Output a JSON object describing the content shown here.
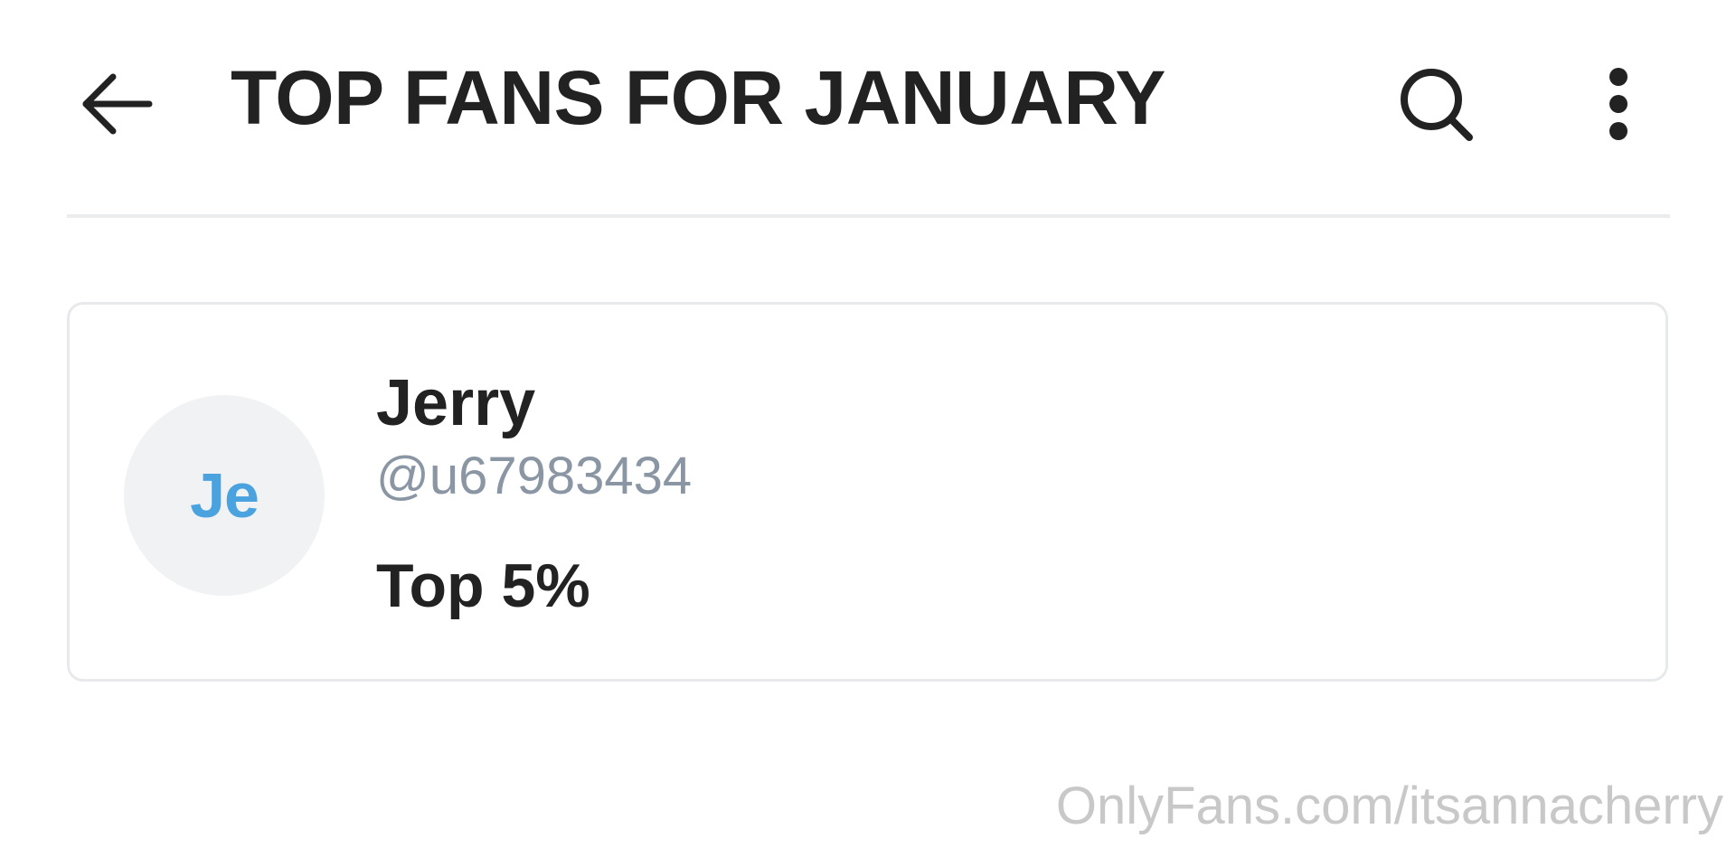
{
  "header": {
    "title": "TOP FANS FOR JANUARY",
    "back_icon": "arrow-left-icon",
    "search_icon": "search-icon",
    "more_icon": "more-vertical-icon"
  },
  "fan": {
    "initials": "Je",
    "name": "Jerry",
    "handle": "@u67983434",
    "rank": "Top 5%"
  },
  "watermark": "OnlyFans.com/itsannacherry",
  "colors": {
    "text_primary": "#222222",
    "text_secondary": "#8a96a3",
    "accent": "#4aa3df",
    "avatar_bg": "#f0f2f4",
    "divider": "#ebeced",
    "watermark": "#c8c8c8"
  }
}
